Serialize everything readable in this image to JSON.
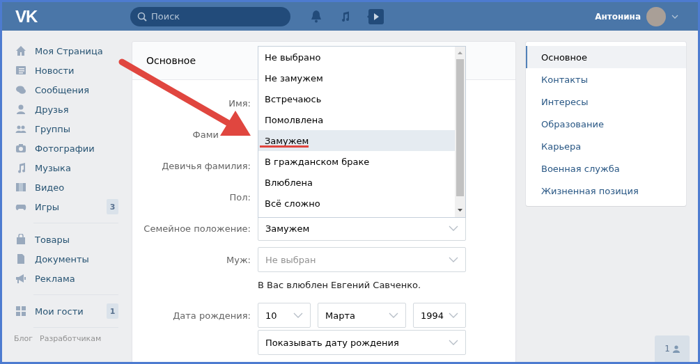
{
  "header": {
    "logo": "VK",
    "search": {
      "placeholder": "Поиск"
    },
    "user_name": "Антонина"
  },
  "sidebar": {
    "groups": [
      [
        {
          "label": "Моя Страница"
        },
        {
          "label": "Новости"
        },
        {
          "label": "Сообщения"
        },
        {
          "label": "Друзья"
        },
        {
          "label": "Группы"
        },
        {
          "label": "Фотографии"
        },
        {
          "label": "Музыка"
        },
        {
          "label": "Видео"
        },
        {
          "label": "Игры",
          "badge": "3"
        }
      ],
      [
        {
          "label": "Товары"
        },
        {
          "label": "Документы"
        },
        {
          "label": "Реклама"
        }
      ],
      [
        {
          "label": "Мои гости",
          "badge": "1"
        }
      ]
    ],
    "footer_links": [
      "Блог",
      "Разработчикам"
    ]
  },
  "main": {
    "title": "Основное",
    "rows": [
      {
        "kind": "label_only",
        "label": "Имя:"
      },
      {
        "kind": "label_covered",
        "label": "Фами"
      },
      {
        "kind": "label_only",
        "label": "Девичья фамилия:"
      },
      {
        "kind": "label_only",
        "label": "Пол:"
      },
      {
        "kind": "select",
        "label": "Семейное положение:",
        "value": "Замужем"
      },
      {
        "kind": "select",
        "label": "Муж:",
        "placeholder": "Не выбран"
      },
      {
        "kind": "note",
        "text": "В Вас влюблен Евгений Савченко."
      },
      {
        "kind": "date",
        "label": "Дата рождения:",
        "parts": [
          "10",
          "Марта",
          "1994"
        ]
      },
      {
        "kind": "select",
        "value": "Показывать дату рождения"
      }
    ],
    "dropdown": {
      "options": [
        {
          "label": "Не выбрано",
          "selected": false
        },
        {
          "label": "Не замужем",
          "selected": false
        },
        {
          "label": "Встречаюсь",
          "selected": false
        },
        {
          "label": "Помолвлена",
          "selected": false
        },
        {
          "label": "Замужем",
          "selected": true
        },
        {
          "label": "В гражданском браке",
          "selected": false
        },
        {
          "label": "Влюблена",
          "selected": false
        },
        {
          "label": "Всё сложно",
          "selected": false
        }
      ]
    }
  },
  "right_menu": {
    "items": [
      {
        "label": "Основное",
        "selected": true
      },
      {
        "label": "Контакты",
        "selected": false
      },
      {
        "label": "Интересы",
        "selected": false
      },
      {
        "label": "Образование",
        "selected": false
      },
      {
        "label": "Карьера",
        "selected": false
      },
      {
        "label": "Военная служба",
        "selected": false
      },
      {
        "label": "Жизненная позиция",
        "selected": false
      }
    ]
  },
  "friends_button": {
    "count": "1"
  }
}
